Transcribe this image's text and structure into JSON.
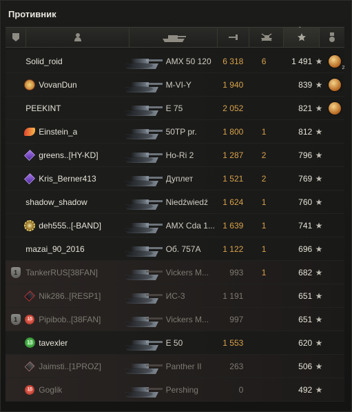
{
  "title": "Противник",
  "header": {
    "icons": [
      "squad-icon",
      "player-icon",
      "tank-icon",
      "damage-icon",
      "frags-icon",
      "xp-icon",
      "medal-icon"
    ],
    "sort_indicator": "ˇ"
  },
  "star_glyph": "★",
  "players": [
    {
      "squad": "",
      "badge": "none",
      "nick": "Solid_roid",
      "tank": "AMX 50 120",
      "damage": "6 318",
      "frags": "6",
      "xp": "1 491",
      "medal": true,
      "medal_count": "2",
      "dead": false,
      "platoon": false
    },
    {
      "squad": "",
      "badge": "gold",
      "nick": "VovanDun",
      "tank": "M-VI-Y",
      "damage": "1 940",
      "frags": "",
      "xp": "839",
      "medal": true,
      "medal_count": "",
      "dead": false,
      "platoon": false
    },
    {
      "squad": "",
      "badge": "none",
      "nick": "PEEKINT",
      "tank": "E 75",
      "damage": "2 052",
      "frags": "",
      "xp": "821",
      "medal": true,
      "medal_count": "",
      "dead": false,
      "platoon": false
    },
    {
      "squad": "",
      "badge": "flame",
      "nick": "Einstein_a",
      "tank": "50TP pr.",
      "damage": "1 800",
      "frags": "1",
      "xp": "812",
      "medal": false,
      "medal_count": "",
      "dead": false,
      "platoon": false
    },
    {
      "squad": "",
      "badge": "purple",
      "nick": "greens..[HY-KD]",
      "tank": "Ho-Ri 2",
      "damage": "1 287",
      "frags": "2",
      "xp": "796",
      "medal": false,
      "medal_count": "",
      "dead": false,
      "platoon": false
    },
    {
      "squad": "",
      "badge": "purple",
      "nick": "Kris_Berner413",
      "tank": "Дуплет",
      "damage": "1 521",
      "frags": "2",
      "xp": "769",
      "medal": false,
      "medal_count": "",
      "dead": false,
      "platoon": false
    },
    {
      "squad": "",
      "badge": "none",
      "nick": "shadow_shadow",
      "tank": "Niedźwiedź",
      "damage": "1 624",
      "frags": "1",
      "xp": "760",
      "medal": false,
      "medal_count": "",
      "dead": false,
      "platoon": false
    },
    {
      "squad": "",
      "badge": "gear",
      "nick": "deh555..[-BAND]",
      "tank": "AMX Cda 1...",
      "damage": "1 639",
      "frags": "1",
      "xp": "741",
      "medal": false,
      "medal_count": "",
      "dead": false,
      "platoon": false
    },
    {
      "squad": "",
      "badge": "none",
      "nick": "mazai_90_2016",
      "tank": "Об. 757А",
      "damage": "1 122",
      "frags": "1",
      "xp": "696",
      "medal": false,
      "medal_count": "",
      "dead": false,
      "platoon": false
    },
    {
      "squad": "1",
      "badge": "none",
      "nick": "TankerRUS[38FAN]",
      "tank": "Vickers M...",
      "damage": "993",
      "frags": "1",
      "xp": "682",
      "medal": false,
      "medal_count": "",
      "dead": true,
      "platoon": true
    },
    {
      "squad": "",
      "badge": "dark",
      "nick": "Nik286..[RESP1]",
      "tank": "ИС-3",
      "damage": "1 191",
      "frags": "",
      "xp": "651",
      "medal": false,
      "medal_count": "",
      "dead": true,
      "platoon": true
    },
    {
      "squad": "1",
      "badge": "red",
      "nick": "Pipibob..[38FAN]",
      "tank": "Vickers M...",
      "damage": "997",
      "frags": "",
      "xp": "651",
      "medal": false,
      "medal_count": "",
      "dead": true,
      "platoon": true
    },
    {
      "squad": "",
      "badge": "green",
      "nick": "tavexler",
      "tank": "E 50",
      "damage": "1 553",
      "frags": "",
      "xp": "620",
      "medal": false,
      "medal_count": "",
      "dead": false,
      "platoon": false
    },
    {
      "squad": "",
      "badge": "dark2",
      "nick": "Jaimsti..[1PROZ]",
      "tank": "Panther II",
      "damage": "263",
      "frags": "",
      "xp": "506",
      "medal": false,
      "medal_count": "",
      "dead": true,
      "platoon": true
    },
    {
      "squad": "",
      "badge": "red",
      "nick": "Goglik",
      "tank": "Pershing",
      "damage": "0",
      "frags": "",
      "xp": "492",
      "medal": false,
      "medal_count": "",
      "dead": true,
      "platoon": true
    }
  ],
  "badge_labels": {
    "green": "13",
    "red": "15"
  }
}
